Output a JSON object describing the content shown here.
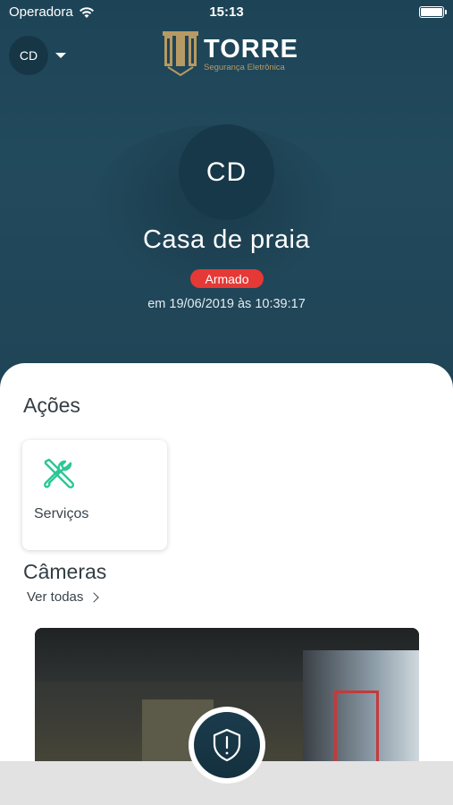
{
  "status_bar": {
    "carrier": "Operadora",
    "time": "15:13"
  },
  "header": {
    "user_initials": "CD",
    "logo": {
      "brand": "TORRE",
      "tagline": "Segurança Eletrônica"
    }
  },
  "site": {
    "initials": "CD",
    "name": "Casa de praia",
    "status": "Armado",
    "status_color": "#e53935",
    "status_date": "em 19/06/2019 às 10:39:17"
  },
  "actions": {
    "title": "Ações",
    "items": [
      {
        "label": "Serviços",
        "icon": "tools-icon",
        "icon_color": "#2cc795"
      }
    ]
  },
  "cameras": {
    "title": "Câmeras",
    "see_all": "Ver todas"
  },
  "panic": {
    "icon": "shield-alert-icon"
  },
  "colors": {
    "header_bg": "#1f4456",
    "accent": "#2cc795",
    "logo_gold": "#b79a63"
  }
}
